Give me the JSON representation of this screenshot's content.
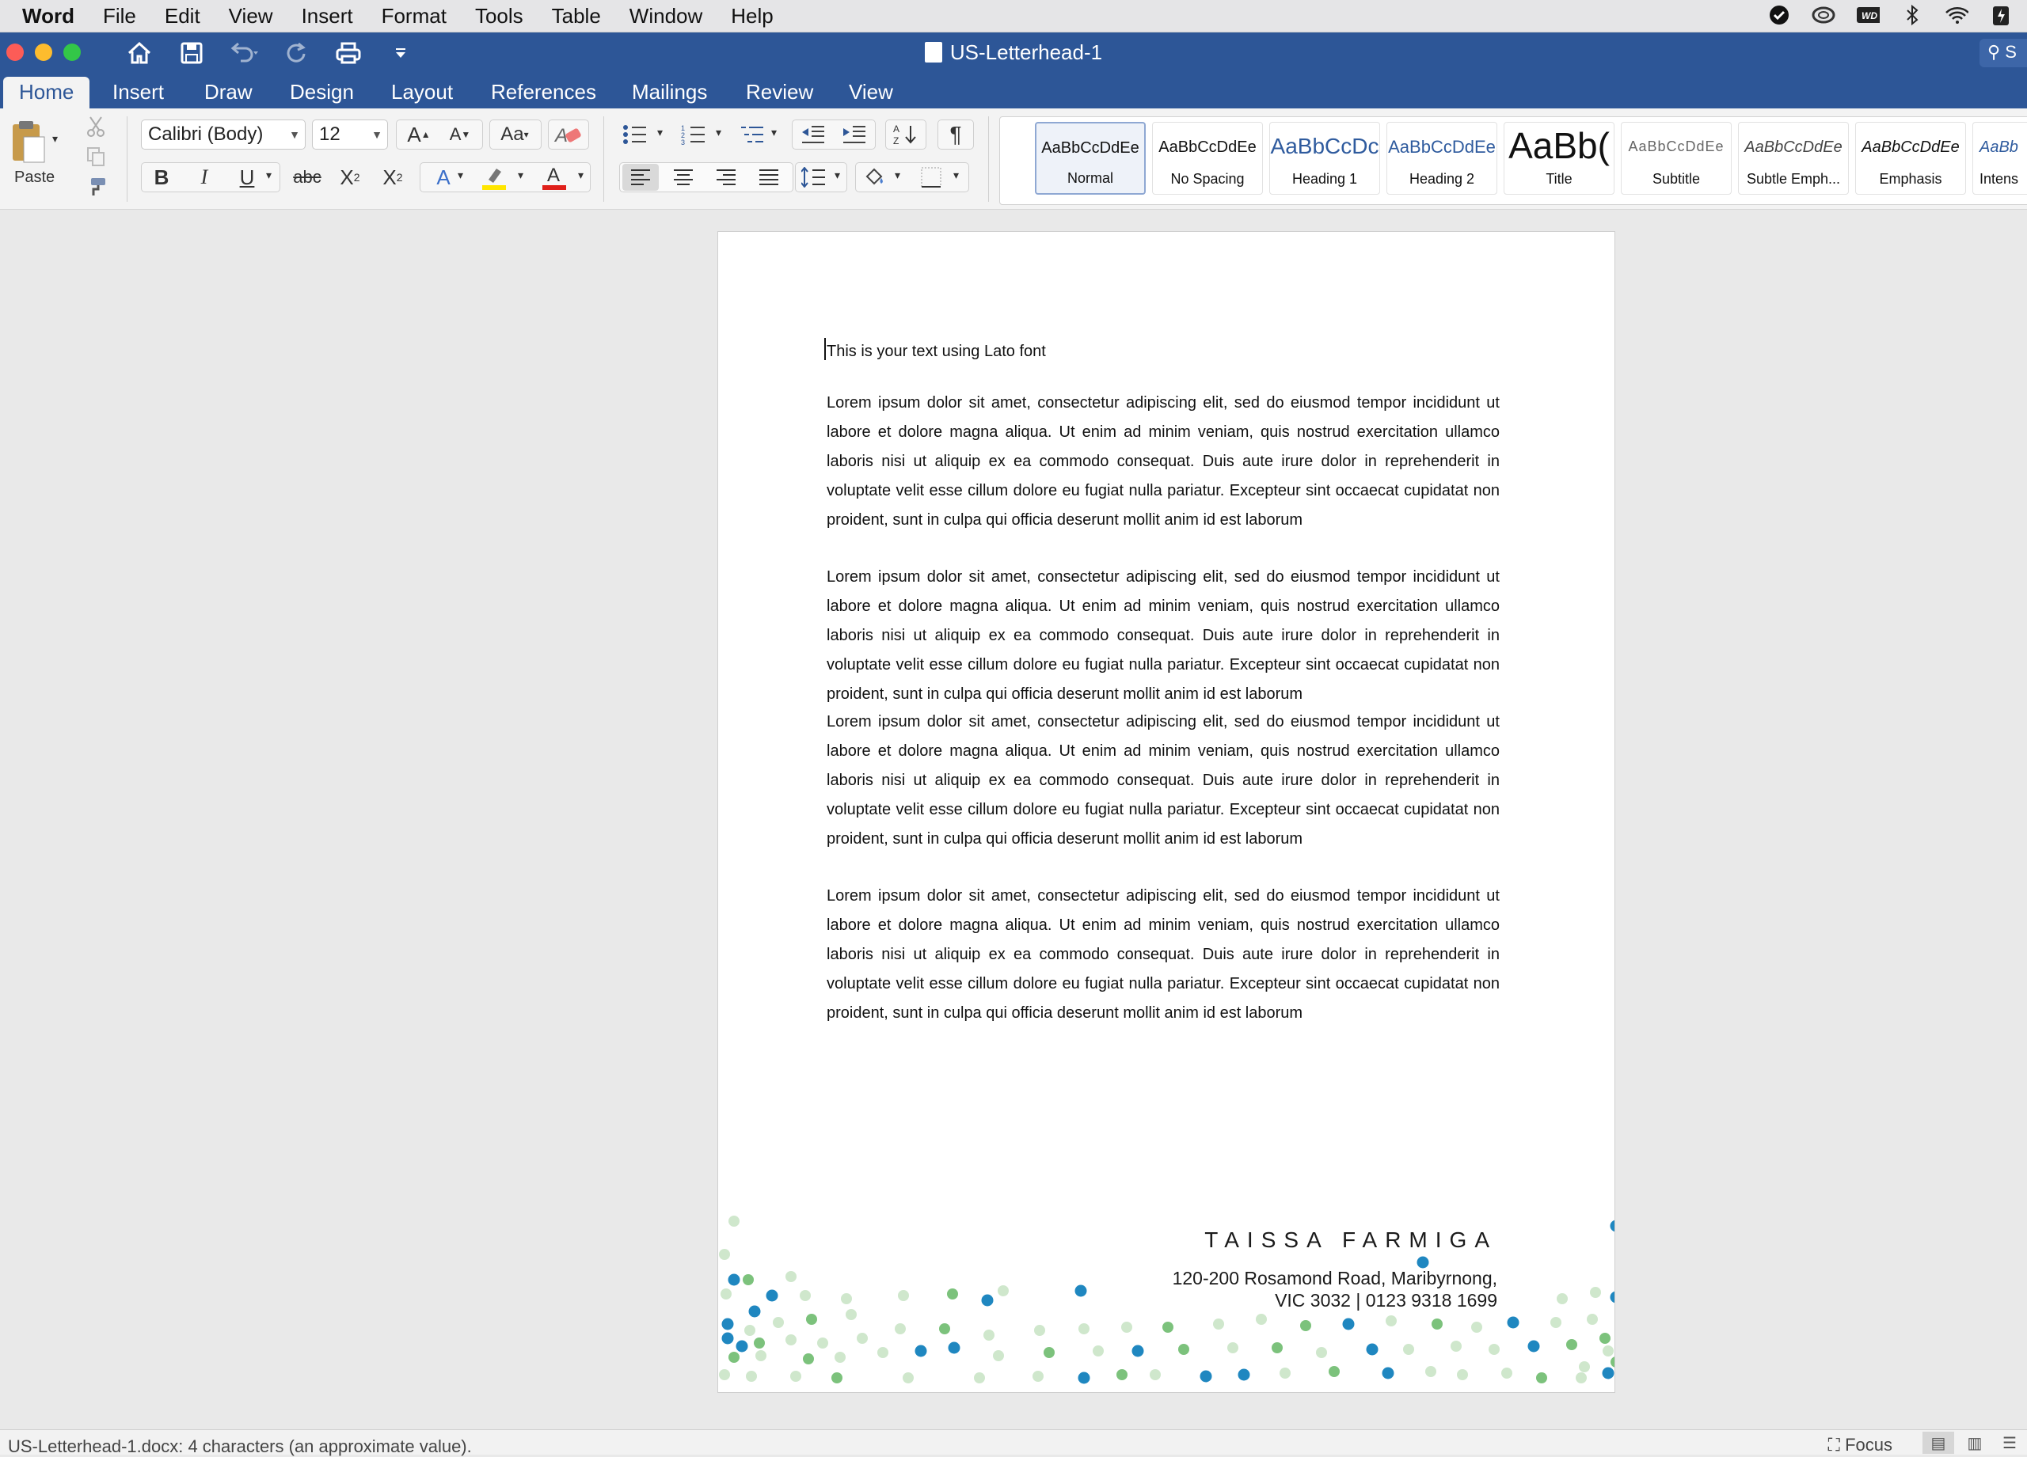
{
  "menubar": {
    "app": "Word",
    "items": [
      "File",
      "Edit",
      "View",
      "Insert",
      "Format",
      "Tools",
      "Table",
      "Window",
      "Help"
    ]
  },
  "window": {
    "title": "US-Letterhead-1",
    "search_hint": "S"
  },
  "tabs": [
    "Home",
    "Insert",
    "Draw",
    "Design",
    "Layout",
    "References",
    "Mailings",
    "Review",
    "View"
  ],
  "active_tab": "Home",
  "ribbon": {
    "paste_label": "Paste",
    "font_name": "Calibri (Body)",
    "font_size": "12",
    "strike_label": "abc",
    "styles": [
      {
        "preview": "AaBbCcDdEe",
        "name": "Normal",
        "selected": true
      },
      {
        "preview": "AaBbCcDdEe",
        "name": "No Spacing"
      },
      {
        "preview": "AaBbCcDc",
        "name": "Heading 1"
      },
      {
        "preview": "AaBbCcDdEe",
        "name": "Heading 2"
      },
      {
        "preview": "AaBb(",
        "name": "Title"
      },
      {
        "preview": "AaBbCcDdEe",
        "name": "Subtitle"
      },
      {
        "preview": "AaBbCcDdEe",
        "name": "Subtle Emph..."
      },
      {
        "preview": "AaBbCcDdEe",
        "name": "Emphasis"
      },
      {
        "preview": "AaBb",
        "name": "Intens"
      }
    ]
  },
  "document": {
    "first_line": "This is your text using Lato font",
    "paragraphs": [
      "Lorem ipsum dolor sit amet, consectetur adipiscing elit, sed do eiusmod tempor incididunt ut labore et dolore magna aliqua. Ut enim ad minim veniam, quis nostrud exercitation ullamco laboris nisi ut aliquip ex ea commodo consequat. Duis aute irure dolor in reprehenderit in voluptate velit esse cillum dolore eu fugiat nulla pariatur. Excepteur sint occaecat cupidatat non proident, sunt in culpa qui officia deserunt mollit anim id est laborum",
      "Lorem ipsum dolor sit amet, consectetur adipiscing elit, sed do eiusmod tempor incididunt ut labore et dolore magna aliqua. Ut enim ad minim veniam, quis nostrud exercitation ullamco laboris nisi ut aliquip ex ea commodo consequat. Duis aute irure dolor in reprehenderit in voluptate velit esse cillum dolore eu fugiat nulla pariatur. Excepteur sint occaecat cupidatat non proident, sunt in culpa qui officia deserunt mollit anim id est laborum",
      "Lorem ipsum dolor sit amet, consectetur adipiscing elit, sed do eiusmod tempor incididunt ut labore et dolore magna aliqua. Ut enim ad minim veniam, quis nostrud exercitation ullamco laboris nisi ut aliquip ex ea commodo consequat. Duis aute irure dolor in reprehenderit in voluptate velit esse cillum dolore eu fugiat nulla pariatur. Excepteur sint occaecat cupidatat non proident, sunt in culpa qui officia deserunt mollit anim id est laborum",
      "Lorem ipsum dolor sit amet, consectetur adipiscing elit, sed do eiusmod tempor incididunt ut labore et dolore magna aliqua. Ut enim ad minim veniam, quis nostrud exercitation ullamco laboris nisi ut aliquip ex ea commodo consequat. Duis aute irure dolor in reprehenderit in voluptate velit esse cillum dolore eu fugiat nulla pariatur. Excepteur sint occaecat cupidatat non proident, sunt in culpa qui officia deserunt mollit anim id est laborum"
    ],
    "footer_name": "TAISSA FARMIGA",
    "footer_address_1": "120-200 Rosamond Road, Maribyrnong,",
    "footer_address_2": "VIC 3032   |  0123 9318 1699"
  },
  "statusbar": {
    "text": "US-Letterhead-1.docx: 4 characters (an approximate value).",
    "focus_label": "Focus"
  },
  "colors": {
    "title_bar": "#2d5697",
    "dot_blue": "#1f87c0",
    "dot_green": "#7cc27c",
    "dot_light_green": "#cfe7cc",
    "font_color_bar": "#e0201b",
    "highlight_bar": "#ffe600"
  }
}
